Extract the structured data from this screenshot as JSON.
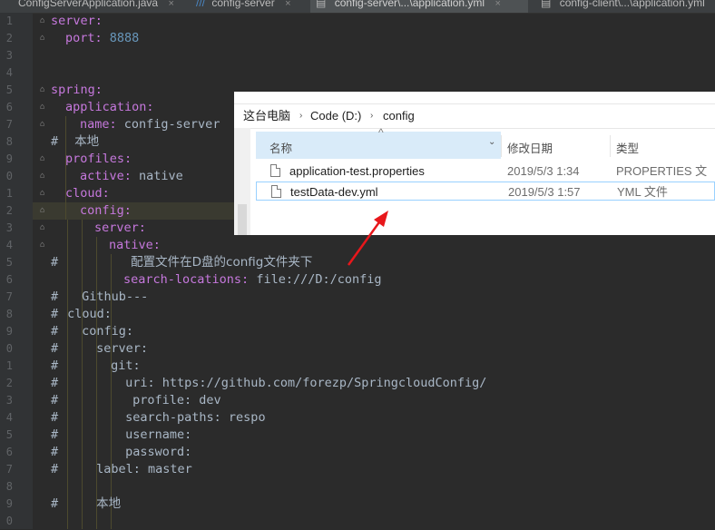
{
  "tabs": [
    {
      "label": "ConfigServerApplication.java",
      "active": false
    },
    {
      "label": "config-server",
      "active": false
    },
    {
      "label": "config-server\\...\\application.yml",
      "active": true
    },
    {
      "label": "config-client\\...\\application.yml",
      "active": false
    }
  ],
  "tab_close_glyph": "×",
  "line_numbers": [
    "1",
    "2",
    "3",
    "4",
    "5",
    "6",
    "7",
    "8",
    "9",
    "0",
    "1",
    "2",
    "3",
    "4",
    "5",
    "6",
    "7",
    "8",
    "9",
    "0",
    "1",
    "2",
    "3",
    "4",
    "5",
    "6",
    "7",
    "8",
    "9",
    "0"
  ],
  "code": {
    "l1_key": "server:",
    "l2_key": "port:",
    "l2_val": "8888",
    "l5_key": "spring:",
    "l6_key": "application:",
    "l7_key": "name:",
    "l7_val": "config-server",
    "l8_hash": "#",
    "l8_text": "本地",
    "l9_key": "profiles:",
    "l10_key": "active:",
    "l10_val": "native",
    "l11_key": "cloud:",
    "l12_key": "config:",
    "l13_key": "server:",
    "l14_key": "native:",
    "l15_hash": "#",
    "l15_text": "配置文件在D盘的config文件夹下",
    "l16_key": "search-locations:",
    "l16_val": "file:///D:/config",
    "l17_hash": "#",
    "l17_text": "Github---",
    "l18_hash": "#",
    "l18_text": "cloud:",
    "l19_hash": "#",
    "l19_text": "config:",
    "l20_hash": "#",
    "l20_text": "server:",
    "l21_hash": "#",
    "l21_text": "git:",
    "l22_hash": "#",
    "l22_text": "uri: https://github.com/forezp/SpringcloudConfig/",
    "l23_hash": "#",
    "l23_text": "profile: dev",
    "l24_hash": "#",
    "l24_text": "search-paths: respo",
    "l25_hash": "#",
    "l25_text": "username:",
    "l26_hash": "#",
    "l26_text": "password:",
    "l27_hash": "#",
    "l27_text": "label: master",
    "l29_hash": "#",
    "l29_text": "本地"
  },
  "explorer": {
    "breadcrumb": [
      "这台电脑",
      "Code (D:)",
      "config"
    ],
    "breadcrumb_sep": "›",
    "columns": {
      "name": "名称",
      "date": "修改日期",
      "type": "类型"
    },
    "sort_glyph": "^",
    "dropdown_glyph": "⌄",
    "files": [
      {
        "name": "application-test.properties",
        "date": "2019/5/3 1:34",
        "type": "PROPERTIES 文件",
        "selected": false
      },
      {
        "name": "testData-dev.yml",
        "date": "2019/5/3 1:57",
        "type": "YML 文件",
        "selected": true
      }
    ]
  },
  "colors": {
    "editor_bg": "#2b2b2b",
    "yaml_key": "#c678dd",
    "number": "#6897bb",
    "arrow": "#e8171b",
    "selection_border": "#99d1ff"
  }
}
